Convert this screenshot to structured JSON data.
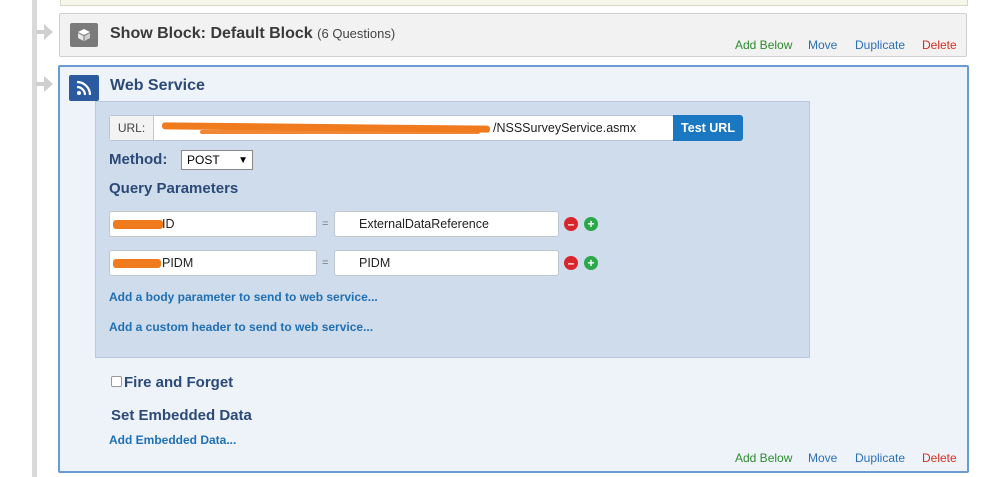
{
  "show_block": {
    "title": "Show Block: Default Block",
    "count": "(6 Questions)",
    "actions": {
      "add_below": "Add Below",
      "move": "Move",
      "duplicate": "Duplicate",
      "delete": "Delete"
    }
  },
  "web_service": {
    "title": "Web Service",
    "url_label": "URL:",
    "url_value": "/NSSSurveyService.asmx",
    "test_url": "Test URL",
    "method_label": "Method:",
    "method_value": "POST",
    "query_params_title": "Query Parameters",
    "params": [
      {
        "key": "ID",
        "equals": "=",
        "value": "ExternalDataReference"
      },
      {
        "key": "PIDM",
        "equals": "=",
        "value": "PIDM"
      }
    ],
    "add_body_param": "Add a body parameter to send to web service...",
    "add_custom_header": "Add a custom header to send to web service...",
    "fire_and_forget": "Fire and Forget",
    "set_embedded_data": "Set Embedded Data",
    "add_embedded_data": "Add Embedded Data...",
    "actions": {
      "add_below": "Add Below",
      "move": "Move",
      "duplicate": "Duplicate",
      "delete": "Delete"
    }
  },
  "colors": {
    "accent": "#1a78c2",
    "add": "#2e8b2e",
    "delete": "#d0301e",
    "redaction": "#f07a1e"
  }
}
